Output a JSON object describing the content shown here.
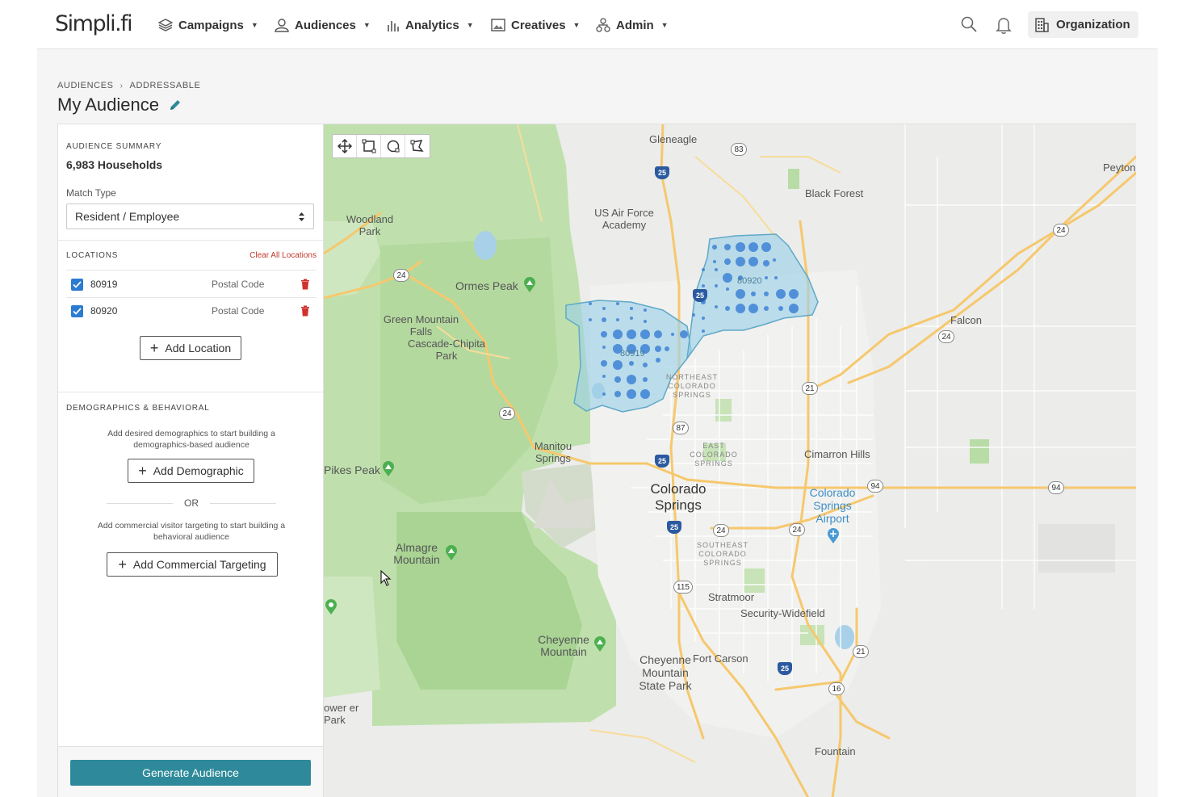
{
  "brand": {
    "logo_text": "Simpli.fi",
    "accent": "#2e8a9a",
    "checkbox_color": "#2b7bd1",
    "danger": "#c0392b"
  },
  "nav": {
    "items": [
      {
        "label": "Campaigns",
        "icon": "layers-icon"
      },
      {
        "label": "Audiences",
        "icon": "users-icon"
      },
      {
        "label": "Analytics",
        "icon": "bar-chart-icon"
      },
      {
        "label": "Creatives",
        "icon": "image-icon"
      },
      {
        "label": "Admin",
        "icon": "org-chart-icon"
      }
    ],
    "search_icon": "search-icon",
    "bell_icon": "bell-icon",
    "org_label": "Organization"
  },
  "breadcrumb": {
    "parent": "AUDIENCES",
    "current": "ADDRESSABLE"
  },
  "page": {
    "title": "My Audience"
  },
  "summary": {
    "label": "AUDIENCE SUMMARY",
    "households": "6,983 Households",
    "match_type_label": "Match Type",
    "match_type_value": "Resident / Employee"
  },
  "locations": {
    "label": "LOCATIONS",
    "clear_label": "Clear All Locations",
    "items": [
      {
        "code": "80919",
        "type": "Postal Code",
        "checked": true
      },
      {
        "code": "80920",
        "type": "Postal Code",
        "checked": true
      }
    ],
    "add_label": "Add Location"
  },
  "demographics": {
    "label": "DEMOGRAPHICS & BEHAVIORAL",
    "helper_demo": "Add desired demographics to start building a demographics-based audience",
    "add_demo_label": "Add Demographic",
    "or_label": "OR",
    "helper_commercial": "Add commercial visitor targeting to start building a behavioral audience",
    "add_commercial_label": "Add Commercial Targeting"
  },
  "footer": {
    "generate_label": "Generate Audience"
  },
  "map": {
    "tools": [
      "move-icon",
      "rectangle-select-icon",
      "circle-select-icon",
      "polygon-select-icon"
    ],
    "labels": {
      "gleneagle": "Gleneagle",
      "black_forest": "Black Forest",
      "peyton": "Peyton",
      "woodland_park": "Woodland Park",
      "usafa": "US Air Force Academy",
      "ormes_peak": "Ormes Peak",
      "green_mountain_falls": "Green Mountain Falls",
      "cascade": "Cascade-Chipita Park",
      "falcon": "Falcon",
      "manitou": "Manitou Springs",
      "pikes_peak": "Pikes Peak",
      "colorado_springs": "Colorado Springs",
      "cimarron_hills": "Cimarron Hills",
      "cos_airport": "Colorado Springs Airport",
      "almagre": "Almagre Mountain",
      "stratmoor": "Stratmoor",
      "security_widefield": "Security-Widefield",
      "cheyenne_mountain": "Cheyenne Mountain",
      "cheyenne_park": "Cheyenne Mountain State Park",
      "fort_carson": "Fort Carson",
      "fountain": "Fountain",
      "power_park": "ower er Park",
      "ne_cos": "NORTHEAST COLORADO SPRINGS",
      "e_cos": "EAST COLORADO SPRINGS",
      "se_cos": "SOUTHEAST COLORADO SPRINGS",
      "zip_80919": "80919",
      "zip_80920": "80920"
    },
    "shields": {
      "s83": "83",
      "s24a": "24",
      "s24b": "24",
      "s24c": "24",
      "s24d": "24",
      "s24e": "24",
      "s24f": "24",
      "s21a": "21",
      "s21b": "21",
      "s87": "87",
      "s94a": "94",
      "s94b": "94",
      "s115": "115",
      "s16": "16",
      "i25a": "25",
      "i25b": "25",
      "i25c": "25",
      "i25d": "25",
      "i25e": "25"
    }
  }
}
